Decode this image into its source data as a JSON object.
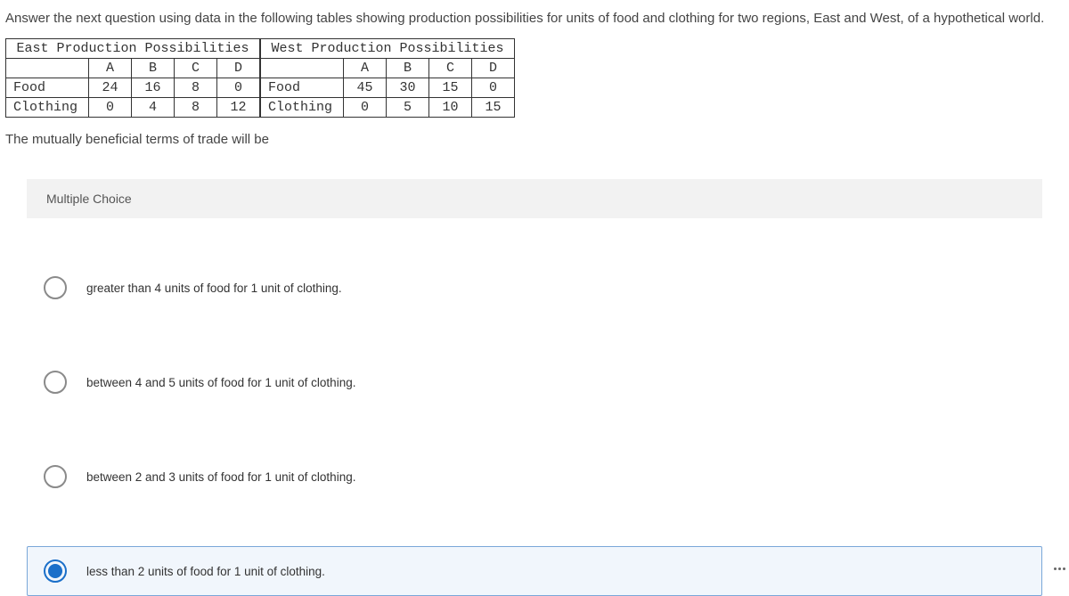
{
  "question": "Answer the next question using data in the following tables showing production possibilities for units of food and clothing for two regions, East and West, of a hypothetical world.",
  "tables": {
    "east": {
      "title": "East Production Possibilities",
      "cols": [
        "A",
        "B",
        "C",
        "D"
      ],
      "rows": [
        {
          "label": "Food",
          "vals": [
            "24",
            "16",
            "8",
            "0"
          ]
        },
        {
          "label": "Clothing",
          "vals": [
            "0",
            "4",
            "8",
            "12"
          ]
        }
      ]
    },
    "west": {
      "title": "West Production Possibilities",
      "cols": [
        "A",
        "B",
        "C",
        "D"
      ],
      "rows": [
        {
          "label": "Food",
          "vals": [
            "45",
            "30",
            "15",
            "0"
          ]
        },
        {
          "label": "Clothing",
          "vals": [
            "0",
            "5",
            "10",
            "15"
          ]
        }
      ]
    }
  },
  "sub_question": "The mutually beneficial terms of trade will be",
  "mc_header": "Multiple Choice",
  "options": [
    {
      "label": "greater than 4 units of food for 1 unit of clothing.",
      "selected": false
    },
    {
      "label": "between 4 and 5 units of food for 1 unit of clothing.",
      "selected": false
    },
    {
      "label": "between 2 and 3 units of food for 1 unit of clothing.",
      "selected": false
    },
    {
      "label": "less than 2 units of food for 1 unit of clothing.",
      "selected": true
    }
  ]
}
